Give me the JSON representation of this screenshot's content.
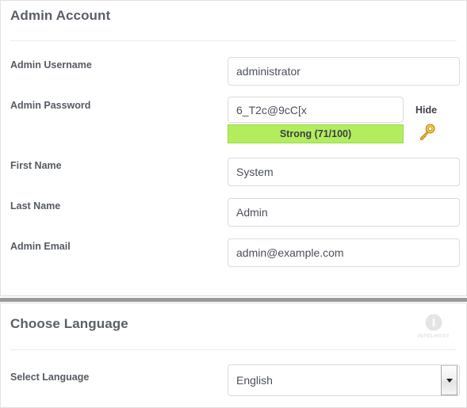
{
  "admin_section": {
    "title": "Admin Account",
    "fields": [
      {
        "label": "Admin Username",
        "value": "administrator",
        "name": "admin-username"
      },
      {
        "label": "Admin Password",
        "value": "6_T2c@9cC[x",
        "name": "admin-password"
      },
      {
        "label": "First Name",
        "value": "System",
        "name": "first-name"
      },
      {
        "label": "Last Name",
        "value": "Admin",
        "name": "last-name"
      },
      {
        "label": "Admin Email",
        "value": "admin@example.com",
        "name": "admin-email"
      }
    ],
    "password_strength": {
      "text": "Strong (71/100)",
      "bar_color": "#b3ed5e",
      "border_color": "#9ad84a"
    },
    "password_toggle_label": "Hide",
    "key_icon_name": "key-icon",
    "key_icon_color": "#e8b93a"
  },
  "language_section": {
    "title": "Choose Language",
    "select_label": "Select Language",
    "selected_language": "English",
    "watermark_text": "INTELHOST"
  }
}
